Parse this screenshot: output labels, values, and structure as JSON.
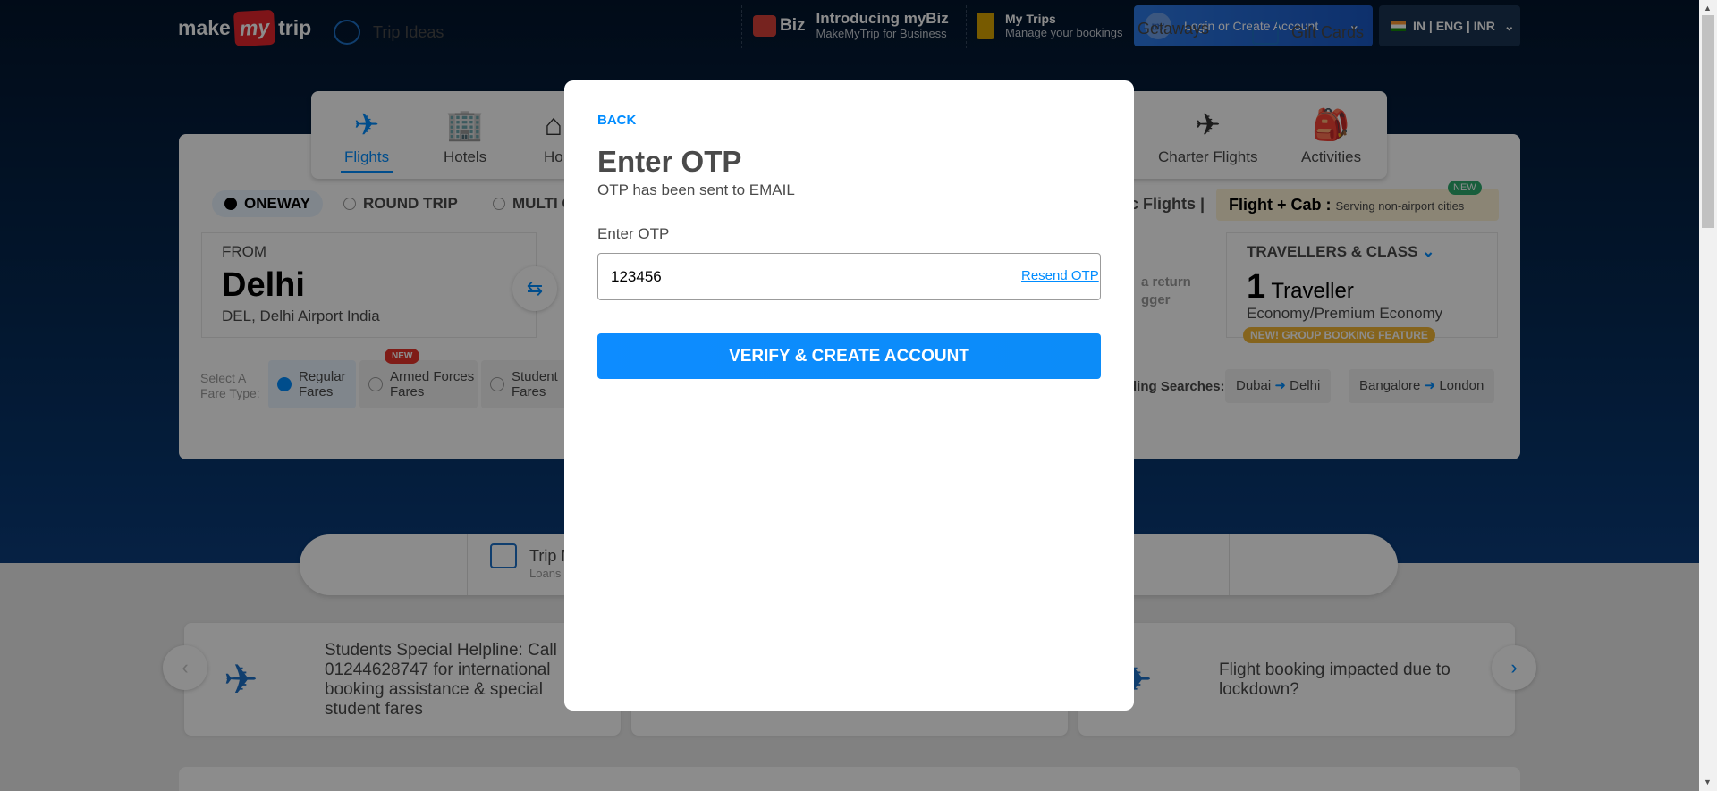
{
  "header": {
    "logo_make": "make",
    "logo_my": "my",
    "logo_trip": "trip",
    "mybiz_badge": "Biz",
    "mybiz_title": "Introducing myBiz",
    "mybiz_sub": "MakeMyTrip for Business",
    "mytrips_title": "My Trips",
    "mytrips_sub": "Manage your bookings",
    "login_label": "Login or Create Account",
    "locale": "IN | ENG | INR"
  },
  "nav": {
    "items": [
      {
        "label": "Flights",
        "icon": "plane-icon"
      },
      {
        "label": "Hotels",
        "icon": "hotel-icon"
      },
      {
        "label": "Ho",
        "icon": "homestay-icon"
      },
      {
        "label": "Charter Flights",
        "icon": "charter-plane-icon"
      },
      {
        "label": "Activities",
        "icon": "hiker-icon"
      }
    ]
  },
  "search": {
    "trip_types": [
      "ONEWAY",
      "ROUND TRIP",
      "MULTI C"
    ],
    "domestic_label": "tic Flights |",
    "flight_cab_title": "Flight + Cab :",
    "flight_cab_sub": "Serving non-airport cities",
    "new_tag": "NEW",
    "from_label": "FROM",
    "from_city": "Delhi",
    "from_sub": "DEL, Delhi Airport India",
    "return_text_1": "a return",
    "return_text_2": "gger",
    "travellers_label": "TRAVELLERS & CLASS",
    "travellers_count": "1",
    "travellers_word": "Traveller",
    "travel_class": "Economy/Premium Economy",
    "group_badge": "NEW! GROUP BOOKING FEATURE",
    "fare_label_1": "Select A",
    "fare_label_2": "Fare Type:",
    "fares": [
      {
        "line1": "Regular",
        "line2": "Fares"
      },
      {
        "line1": "Armed Forces",
        "line2": "Fares"
      },
      {
        "line1": "Student",
        "line2": "Fares"
      }
    ],
    "fare_new_tag": "NEW",
    "trending_label": "ding Searches:",
    "trending": [
      {
        "from": "Dubai",
        "to": "Delhi"
      },
      {
        "from": "Bangalore",
        "to": "London"
      }
    ]
  },
  "quick_links": {
    "trip_ideas": "Trip Ideas",
    "trip_m": "Trip M",
    "trip_m_sub": "Loans",
    "getaways": "Getaways",
    "gift_cards": "Gift Cards"
  },
  "offers": {
    "student_text": "Students Special Helpline: Call 01244628747 for international booking assistance & special student fares",
    "lockdown_text": "Flight booking impacted due to lockdown?"
  },
  "modal": {
    "back_label": "BACK",
    "title": "Enter OTP",
    "subtitle": "OTP has been sent to EMAIL",
    "otp_label": "Enter OTP",
    "otp_value": "123456",
    "resend_label": "Resend OTP",
    "verify_label": "VERIFY & CREATE ACCOUNT"
  },
  "colors": {
    "accent": "#008cff",
    "hero": "#062a55",
    "brand_red": "#e5262d"
  }
}
